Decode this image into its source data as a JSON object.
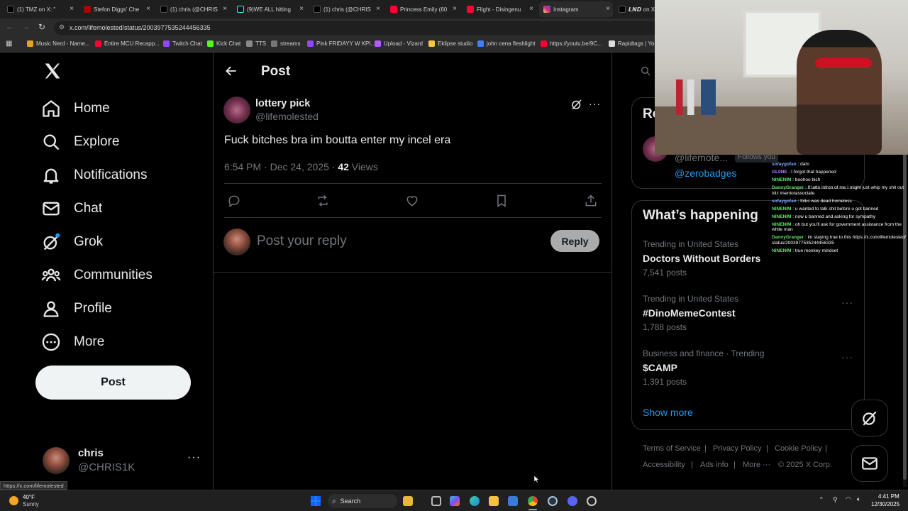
{
  "browser": {
    "tabs": [
      {
        "label": "(1) TMZ on X: \"",
        "color": "#000000"
      },
      {
        "label": "Stefon Diggs' Che",
        "color": "#b00000"
      },
      {
        "label": "(1) chris (@CHRIS",
        "color": "#000000"
      },
      {
        "label": "(9)WE ALL hitting",
        "color": "#000000"
      },
      {
        "label": "(1) chris (@CHRIS",
        "color": "#000000"
      },
      {
        "label": "Princess Emily (60",
        "color": "#ff0033"
      },
      {
        "label": "Flight - Disingenu",
        "color": "#ff0033"
      },
      {
        "label": "Instagram",
        "color": "#d6249f"
      },
      {
        "label": "𝙇𝙉𝘿 on X:",
        "color": "#000000"
      }
    ],
    "url": "x.com/lifemolested/status/2003977535244456335",
    "bookmarks": [
      "Music Nerd - Name...",
      "Entire MCU Recapp...",
      "Twitch Chat",
      "Kick Chat",
      "TTS",
      "streams",
      "Pink FRIDAYY W KPI...",
      "Upload - Vizard",
      "Eklipse studio",
      "john cena fleshlight",
      "https://youtu.be/9C...",
      "Rapidtags | You"
    ],
    "status_link": "https://x.com/lifemolested"
  },
  "nav": {
    "items": [
      "Home",
      "Explore",
      "Notifications",
      "Chat",
      "Grok",
      "Communities",
      "Profile",
      "More"
    ],
    "post_label": "Post"
  },
  "account": {
    "name": "chris",
    "handle": "@CHRIS1K"
  },
  "post": {
    "header": "Post",
    "author_name": "lottery pick",
    "author_handle": "@lifemolested",
    "text": "Fuck bitches bra im boutta enter my incel era",
    "time": "6:54 PM · Dec 24, 2025 · ",
    "views_count": "42",
    "views_label": " Views",
    "reply_placeholder": "Post your reply",
    "reply_button": "Reply"
  },
  "right": {
    "relevant_title_partial": "Re",
    "follows_you": "Follows you",
    "handle_partial": "@lifemote...",
    "bio_link": "@zerobadges",
    "whats_happening": "What’s happening",
    "trends": [
      {
        "category": "Trending in United States",
        "name": "Doctors Without Borders",
        "posts": "7,541 posts"
      },
      {
        "category": "Trending in United States",
        "name": "#DinoMemeContest",
        "posts": "1,788 posts"
      },
      {
        "category": "Business and finance · Trending",
        "name": "$CAMP",
        "posts": "1,391 posts"
      }
    ],
    "show_more": "Show more",
    "footer": [
      "Terms of Service",
      "|",
      "Privacy Policy",
      "|",
      "Cookie Policy",
      "|",
      "Accessibility",
      "|",
      "Ads info",
      "|",
      "More ···",
      "© 2025 X Corp."
    ]
  },
  "chat": [
    {
      "user": "sofaygofan",
      "color": "#7aa7ff",
      "msg": " : dam"
    },
    {
      "user": "GL0NE",
      "color": "#b57cff",
      "msg": " : I forgot that happened"
    },
    {
      "user": "NINENIM",
      "color": "#63e06b",
      "msg": " : boohoo bich"
    },
    {
      "user": "DannyGranger",
      "color": "#63e06b",
      "msg": " : If latto infron of me I might just whip my shit out lolz #seniorassociate"
    },
    {
      "user": "sofaygofan",
      "color": "#7aa7ff",
      "msg": " : folks was dead homeless"
    },
    {
      "user": "NINENIM",
      "color": "#63e06b",
      "msg": " : u wanted to talk shit before u got banned"
    },
    {
      "user": "NINENIM",
      "color": "#63e06b",
      "msg": " : now u banned and asking for sympathy"
    },
    {
      "user": "NINENIM",
      "color": "#63e06b",
      "msg": " : oh but you'll ask for government assistance from the white man"
    },
    {
      "user": "DannyGranger",
      "color": "#63e06b",
      "msg": " : im staying true to this https://x.com/lifemolested/status/2003977535244456335"
    },
    {
      "user": "NINENIM",
      "color": "#63e06b",
      "msg": " : true monkey mindset"
    }
  ],
  "taskbar": {
    "weather_temp": "40°F",
    "weather_desc": "Sunny",
    "search_label": "Search",
    "time": "4:41 PM",
    "date": "12/30/2025"
  },
  "colors": {
    "accent": "#1d9bf0",
    "background": "#000000",
    "border": "#2f3336",
    "muted": "#71767b"
  }
}
